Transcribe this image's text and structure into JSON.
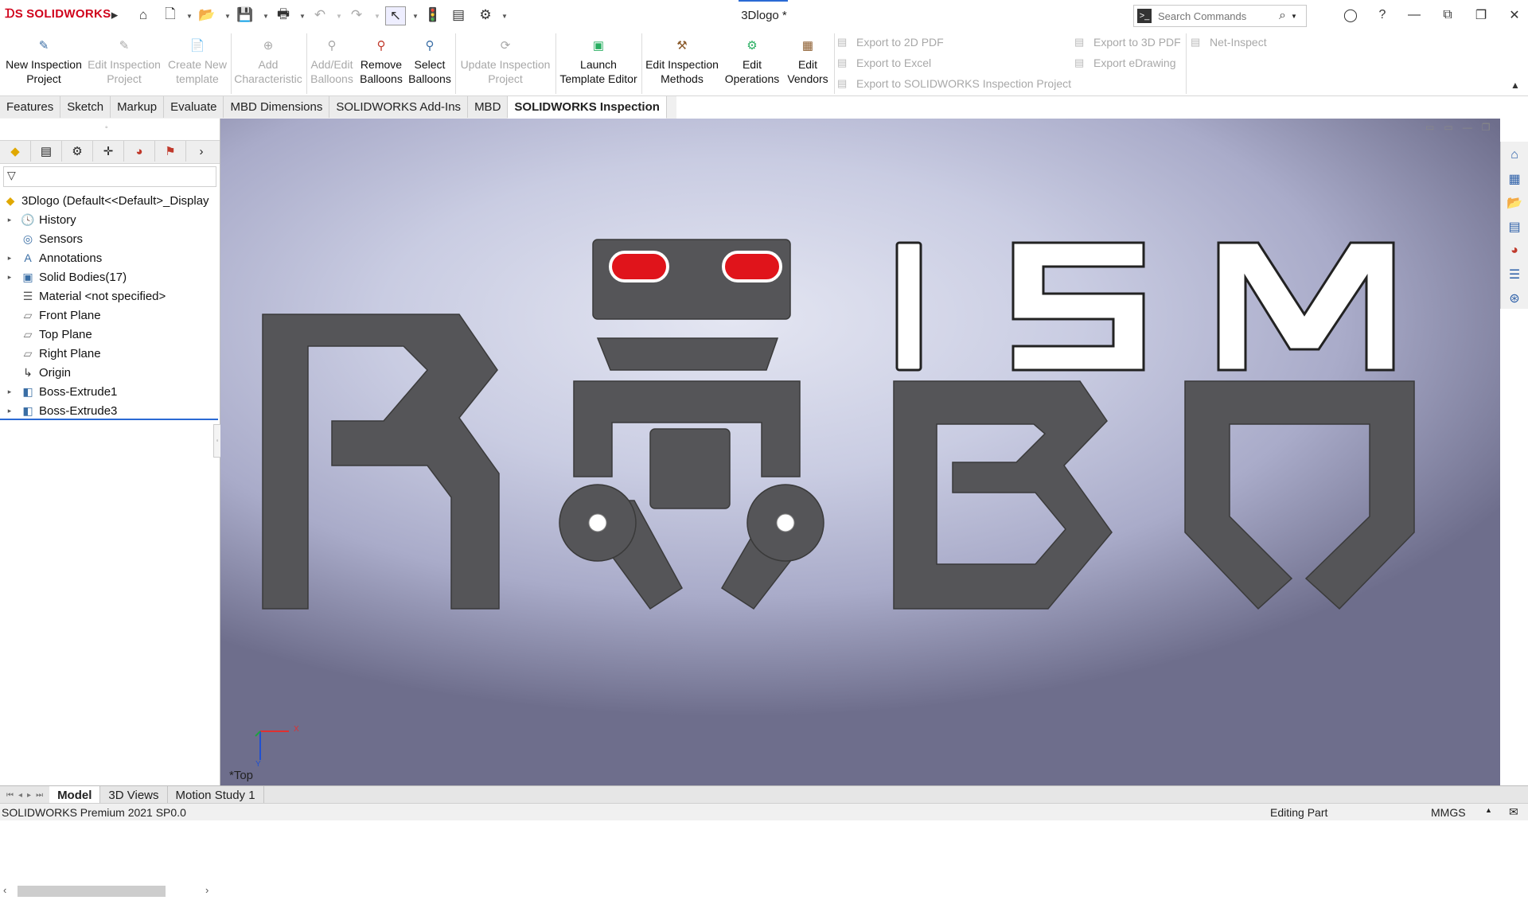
{
  "app": {
    "brand": "SOLIDWORKS",
    "document_title": "3Dlogo *"
  },
  "search": {
    "placeholder": "Search Commands"
  },
  "command_manager": {
    "buttons": [
      {
        "label": "New Inspection Project",
        "enabled": true,
        "icon": "new-inspection-project-icon"
      },
      {
        "label": "Edit Inspection Project",
        "enabled": false,
        "icon": "edit-inspection-project-icon"
      },
      {
        "label": "Create New template",
        "enabled": false,
        "icon": "create-template-icon"
      },
      {
        "label": "Add Characteristic",
        "enabled": false,
        "icon": "add-characteristic-icon"
      },
      {
        "label": "Add/Edit Balloons",
        "enabled": false,
        "icon": "add-balloons-icon"
      },
      {
        "label": "Remove Balloons",
        "enabled": true,
        "icon": "remove-balloons-icon"
      },
      {
        "label": "Select Balloons",
        "enabled": true,
        "icon": "select-balloons-icon"
      },
      {
        "label": "Update Inspection Project",
        "enabled": false,
        "icon": "update-project-icon"
      },
      {
        "label": "Launch Template Editor",
        "enabled": true,
        "icon": "template-editor-icon"
      },
      {
        "label": "Edit Inspection Methods",
        "enabled": true,
        "icon": "inspection-methods-icon"
      },
      {
        "label": "Edit Operations",
        "enabled": true,
        "icon": "operations-icon"
      },
      {
        "label": "Edit Vendors",
        "enabled": true,
        "icon": "vendors-icon"
      }
    ],
    "exports": [
      {
        "label": "Export to 2D PDF",
        "enabled": false
      },
      {
        "label": "Export to Excel",
        "enabled": false
      },
      {
        "label": "Export to SOLIDWORKS Inspection Project",
        "enabled": false
      },
      {
        "label": "Export to 3D PDF",
        "enabled": false
      },
      {
        "label": "Export eDrawing",
        "enabled": false
      },
      {
        "label": "Net-Inspect",
        "enabled": false
      }
    ]
  },
  "tabs": [
    {
      "label": "Features",
      "active": false
    },
    {
      "label": "Sketch",
      "active": false
    },
    {
      "label": "Markup",
      "active": false
    },
    {
      "label": "Evaluate",
      "active": false
    },
    {
      "label": "MBD Dimensions",
      "active": false
    },
    {
      "label": "SOLIDWORKS Add-Ins",
      "active": false
    },
    {
      "label": "MBD",
      "active": false
    },
    {
      "label": "SOLIDWORKS Inspection",
      "active": true
    }
  ],
  "feature_tree": {
    "root": "3Dlogo  (Default<<Default>_Display",
    "items": [
      {
        "label": "History",
        "expandable": true,
        "icon": "history-icon"
      },
      {
        "label": "Sensors",
        "expandable": false,
        "icon": "sensors-icon"
      },
      {
        "label": "Annotations",
        "expandable": true,
        "icon": "annotations-icon"
      },
      {
        "label": "Solid Bodies(17)",
        "expandable": true,
        "icon": "solid-bodies-icon"
      },
      {
        "label": "Material <not specified>",
        "expandable": false,
        "icon": "material-icon"
      },
      {
        "label": "Front Plane",
        "expandable": false,
        "icon": "plane-icon"
      },
      {
        "label": "Top Plane",
        "expandable": false,
        "icon": "plane-icon"
      },
      {
        "label": "Right Plane",
        "expandable": false,
        "icon": "plane-icon"
      },
      {
        "label": "Origin",
        "expandable": false,
        "icon": "origin-icon"
      },
      {
        "label": "Boss-Extrude1",
        "expandable": true,
        "icon": "extrude-icon"
      },
      {
        "label": "Boss-Extrude3",
        "expandable": true,
        "icon": "extrude-icon"
      }
    ]
  },
  "viewport": {
    "view_name": "*Top",
    "triad_x": "X",
    "triad_y": "Y"
  },
  "bottom_tabs": [
    {
      "label": "Model",
      "active": true
    },
    {
      "label": "3D Views",
      "active": false
    },
    {
      "label": "Motion Study 1",
      "active": false
    }
  ],
  "status": {
    "product": "SOLIDWORKS Premium 2021 SP0.0",
    "mode": "Editing Part",
    "units": "MMGS"
  }
}
